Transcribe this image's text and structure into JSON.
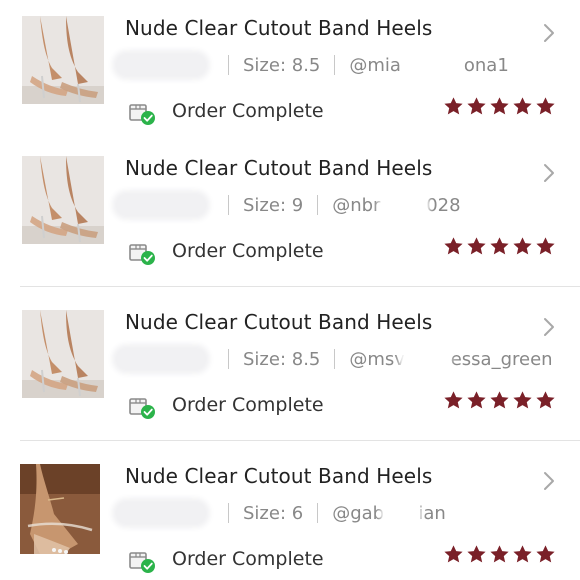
{
  "colors": {
    "star": "#7a2028",
    "check": "#2bb34a",
    "title": "#222222",
    "meta": "#888888",
    "divider": "#e3e3e3"
  },
  "icons": {
    "chevron": "chevron-right-icon",
    "status": "package-check-icon",
    "star": "star-icon"
  },
  "orders": [
    {
      "title": "Nude Clear Cutout Band Heels",
      "size": "Size: 8.5",
      "handle": "@mia           ona1",
      "status": "Order Complete",
      "rating": 5,
      "image": "heels-photo"
    },
    {
      "title": "Nude Clear Cutout Band Heels",
      "size": "Size: 9",
      "handle": "@nbr        028",
      "status": "Order Complete",
      "rating": 5,
      "image": "heels-photo"
    },
    {
      "title": "Nude Clear Cutout Band Heels",
      "size": "Size: 8.5",
      "handle": "@msv        essa_green",
      "status": "Order Complete",
      "rating": 5,
      "image": "heels-photo"
    },
    {
      "title": "Nude Clear Cutout Band Heels",
      "size": "Size: 6",
      "handle": "@gab      ian",
      "status": "Order Complete",
      "rating": 5,
      "image": "heels-closeup-photo"
    }
  ]
}
